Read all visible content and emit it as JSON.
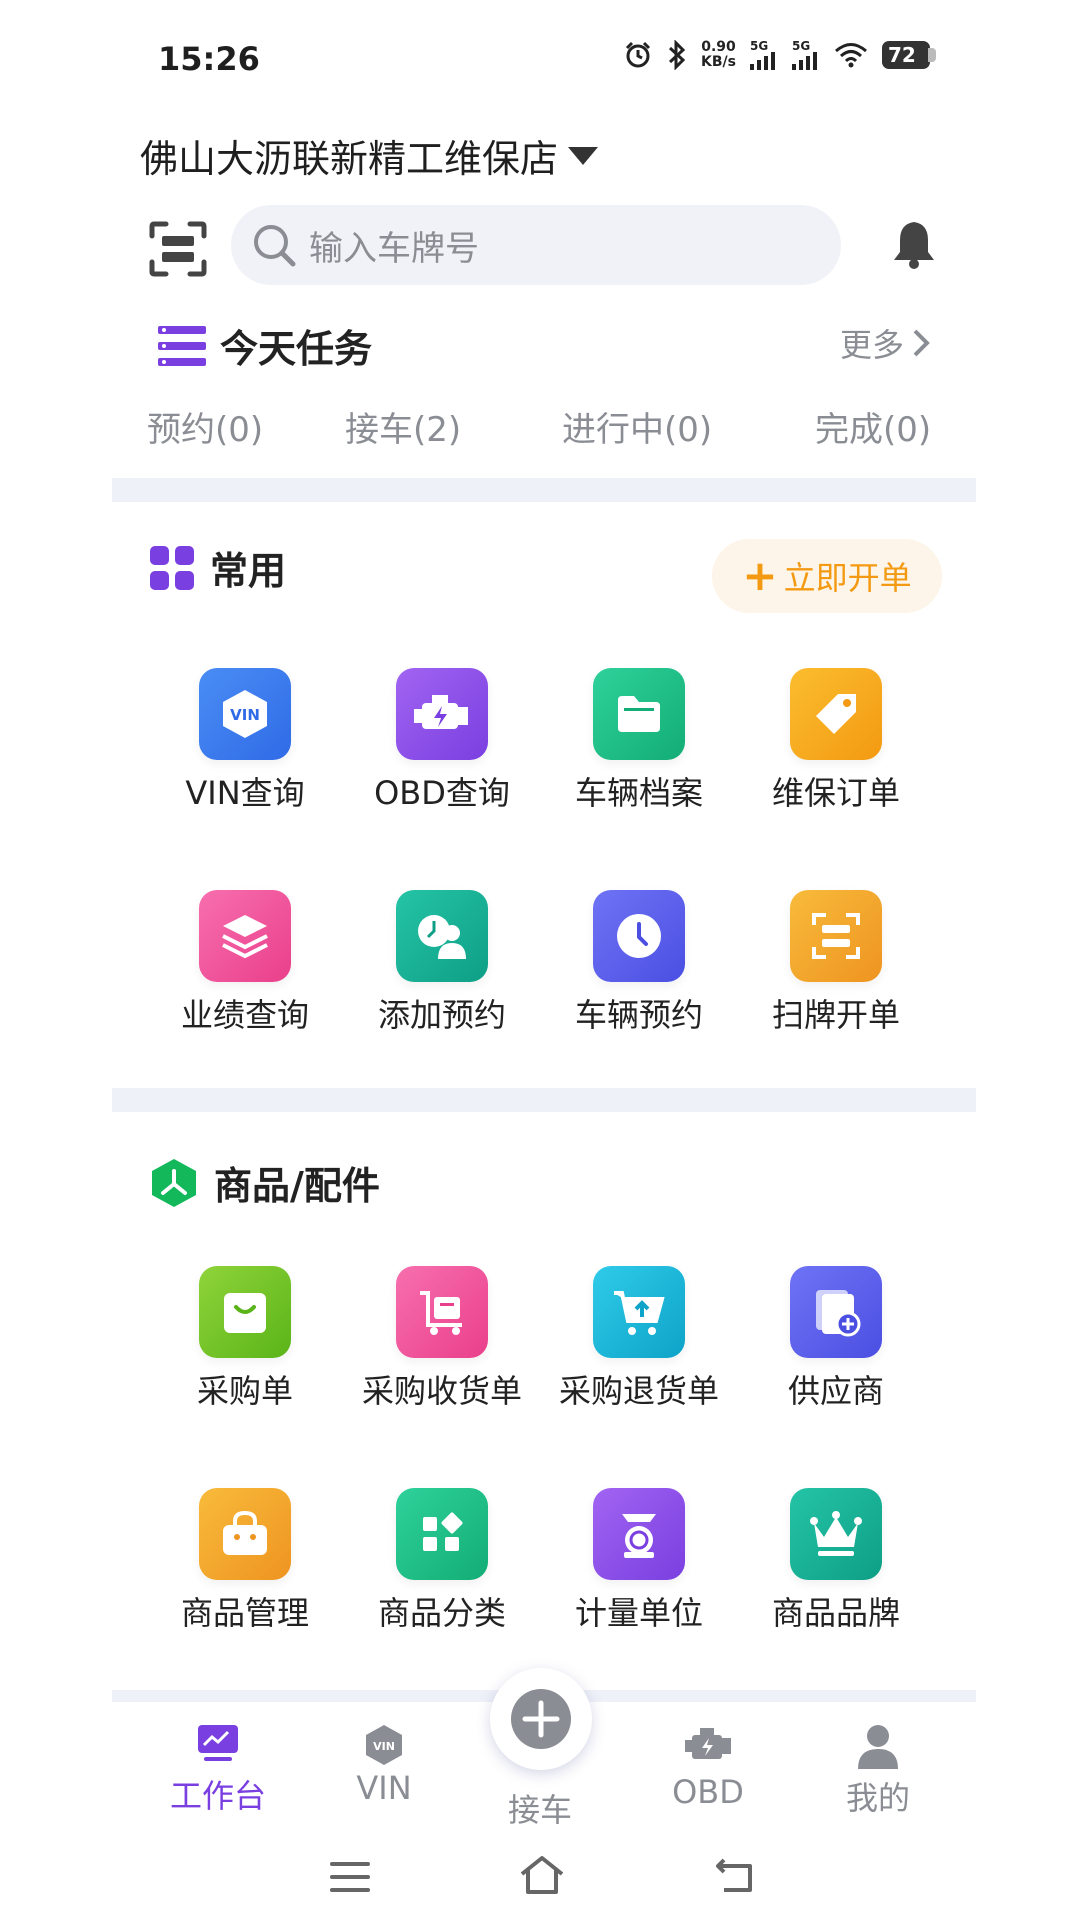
{
  "status_bar": {
    "time": "15:26",
    "net_speed_value": "0.90",
    "net_speed_unit": "KB/s",
    "signal1_label": "5G",
    "signal2_label": "5G",
    "battery": "72",
    "icons": [
      "alarm-icon",
      "bluetooth-icon",
      "signal-icon",
      "wifi-icon",
      "battery-icon"
    ]
  },
  "header": {
    "store_name": "佛山大沥联新精工维保店",
    "search_placeholder": "输入车牌号"
  },
  "tasks": {
    "title": "今天任务",
    "more": "更多",
    "tabs": [
      "预约(0)",
      "接车(2)",
      "进行中(0)",
      "完成(0)"
    ]
  },
  "common": {
    "title": "常用",
    "open_order": "立即开单",
    "items": [
      {
        "label": "VIN查询",
        "icon": "vin-icon",
        "color": "#3a7bf0"
      },
      {
        "label": "OBD查询",
        "icon": "engine-icon",
        "color": "#8a4fe8"
      },
      {
        "label": "车辆档案",
        "icon": "folder-icon",
        "color": "#1fc08a"
      },
      {
        "label": "维保订单",
        "icon": "tag-icon",
        "color": "#f5a417"
      },
      {
        "label": "业绩查询",
        "icon": "layers-icon",
        "color": "#f0509a"
      },
      {
        "label": "添加预约",
        "icon": "appointment-person-icon",
        "color": "#14b39a"
      },
      {
        "label": "车辆预约",
        "icon": "clock-icon",
        "color": "#5a5ef0"
      },
      {
        "label": "扫牌开单",
        "icon": "scan-plate-icon",
        "color": "#f2a52b"
      }
    ]
  },
  "goods": {
    "title": "商品/配件",
    "items": [
      {
        "label": "采购单",
        "icon": "shopping-bag-icon",
        "color": "#6cc21d"
      },
      {
        "label": "采购收货单",
        "icon": "cart-receive-icon",
        "color": "#f0509a"
      },
      {
        "label": "采购退货单",
        "icon": "cart-return-icon",
        "color": "#14b4d8"
      },
      {
        "label": "供应商",
        "icon": "supplier-icon",
        "color": "#5a5ef0"
      },
      {
        "label": "商品管理",
        "icon": "basket-icon",
        "color": "#f2a52b"
      },
      {
        "label": "商品分类",
        "icon": "category-icon",
        "color": "#1fc08a"
      },
      {
        "label": "计量单位",
        "icon": "scale-icon",
        "color": "#8a4fe8"
      },
      {
        "label": "商品品牌",
        "icon": "crown-icon",
        "color": "#14b39a"
      }
    ]
  },
  "bottom_nav": {
    "items": [
      {
        "label": "工作台",
        "icon": "workbench-icon",
        "active": true
      },
      {
        "label": "VIN",
        "icon": "vin-nav-icon",
        "active": false
      },
      {
        "label": "接车",
        "icon": "add-icon",
        "active": false
      },
      {
        "label": "OBD",
        "icon": "obd-engine-icon",
        "active": false
      },
      {
        "label": "我的",
        "icon": "user-icon",
        "active": false
      }
    ]
  },
  "colors": {
    "accent": "#7a3fe0",
    "orange": "#f39a12",
    "muted": "#8a8d93",
    "separator": "#eef1f8"
  }
}
